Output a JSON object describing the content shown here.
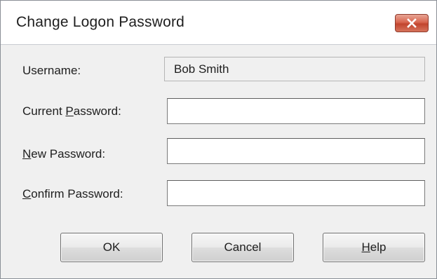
{
  "window": {
    "title": "Change Logon Password",
    "close_icon": "close-x-icon",
    "close_color": "#c7442d"
  },
  "form": {
    "username_label": "Username:",
    "username_value": "Bob Smith",
    "current_password_label_pre": "Current ",
    "current_password_label_acc": "P",
    "current_password_label_post": "assword:",
    "current_password_value": "",
    "new_password_label_pre": "",
    "new_password_label_acc": "N",
    "new_password_label_post": "ew Password:",
    "new_password_value": "",
    "confirm_password_label_pre": "",
    "confirm_password_label_acc": "C",
    "confirm_password_label_post": "onfirm Password:",
    "confirm_password_value": ""
  },
  "buttons": {
    "ok_label": "OK",
    "cancel_label": "Cancel",
    "help_label_acc": "H",
    "help_label_post": "elp"
  }
}
